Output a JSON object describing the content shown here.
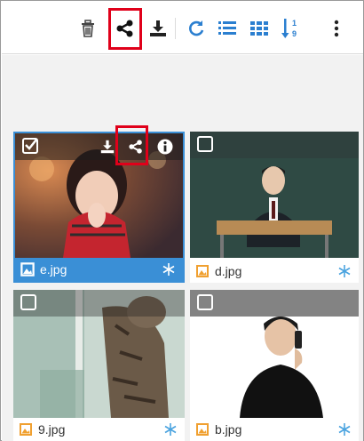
{
  "toolbar": {
    "buttons": [
      {
        "icon": "trash-icon",
        "label": "Delete"
      },
      {
        "icon": "share-icon",
        "label": "Share"
      },
      {
        "icon": "download-icon",
        "label": "Download"
      },
      {
        "icon": "refresh-icon",
        "label": "Refresh"
      },
      {
        "icon": "list-view-icon",
        "label": "List view"
      },
      {
        "icon": "grid-view-icon",
        "label": "Grid view"
      },
      {
        "icon": "sort-numeric-icon",
        "label": "Sort"
      },
      {
        "icon": "more-vertical-icon",
        "label": "More"
      }
    ],
    "accent_color": "#2b7fd0",
    "highlight_color": "#e0001a"
  },
  "files": [
    {
      "name": "e.jpg",
      "selected": true,
      "checked": true,
      "actions": [
        "download-icon",
        "share-icon",
        "info-icon"
      ]
    },
    {
      "name": "d.jpg",
      "selected": false,
      "checked": false
    },
    {
      "name": "9.jpg",
      "selected": false,
      "checked": false
    },
    {
      "name": "b.jpg",
      "selected": false,
      "checked": false
    }
  ],
  "colors": {
    "selection": "#3a8fd6",
    "file_icon": "#f0a030",
    "snowflake": "#4aa3df"
  }
}
